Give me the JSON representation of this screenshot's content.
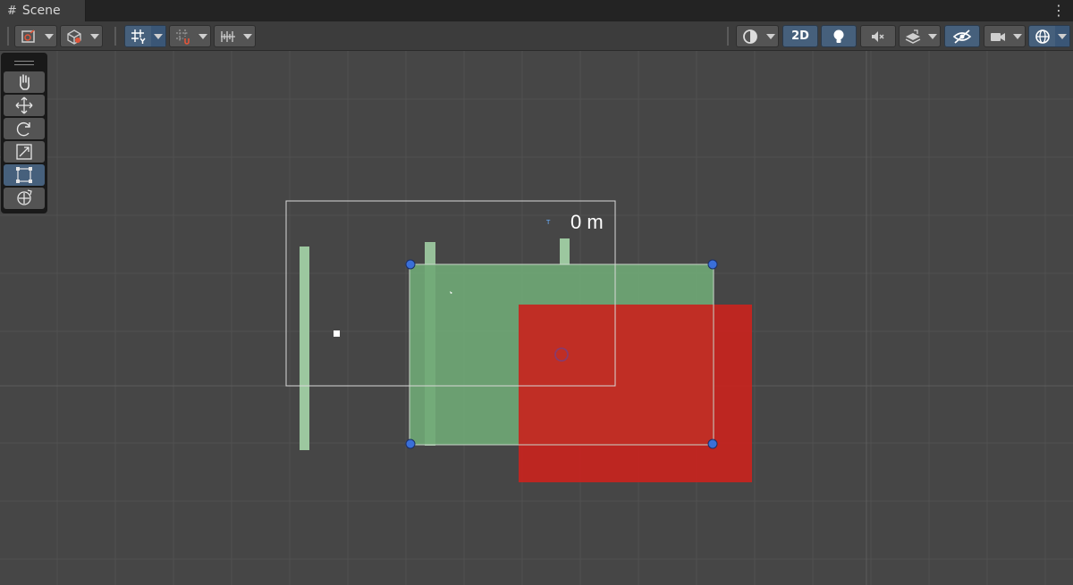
{
  "window": {
    "tab_title": "Scene",
    "menu_glyph": "⋮"
  },
  "toolbar": {
    "mode_2d_label": "2D",
    "buttons": [
      {
        "icon": "draw-mode-icon"
      },
      {
        "icon": "gizmo-cube-icon"
      },
      {
        "icon": "grid-y-icon",
        "active": true
      },
      {
        "icon": "grid-snap-icon"
      },
      {
        "icon": "increment-snap-icon"
      },
      {
        "icon": "shading-mode-icon"
      },
      {
        "icon": "2d-toggle",
        "active": true
      },
      {
        "icon": "lighting-icon",
        "active": true
      },
      {
        "icon": "audio-mute-icon"
      },
      {
        "icon": "effects-layers-icon"
      },
      {
        "icon": "scene-visibility-icon",
        "active": true
      },
      {
        "icon": "camera-icon"
      },
      {
        "icon": "gizmos-globe-icon",
        "active": true
      }
    ]
  },
  "tools": {
    "items": [
      "hand-tool",
      "move-tool",
      "rotate-tool",
      "scale-tool",
      "rect-tool",
      "transform-tool"
    ],
    "active": "rect-tool"
  },
  "scene": {
    "distance_readout": "0 m",
    "colors": {
      "background": "#464646",
      "grid_line": "#505050",
      "green_sprite": "#6fa876",
      "red_sprite": "#c8241e",
      "handle": "#3a6fd8",
      "accent": "#46607c"
    }
  }
}
